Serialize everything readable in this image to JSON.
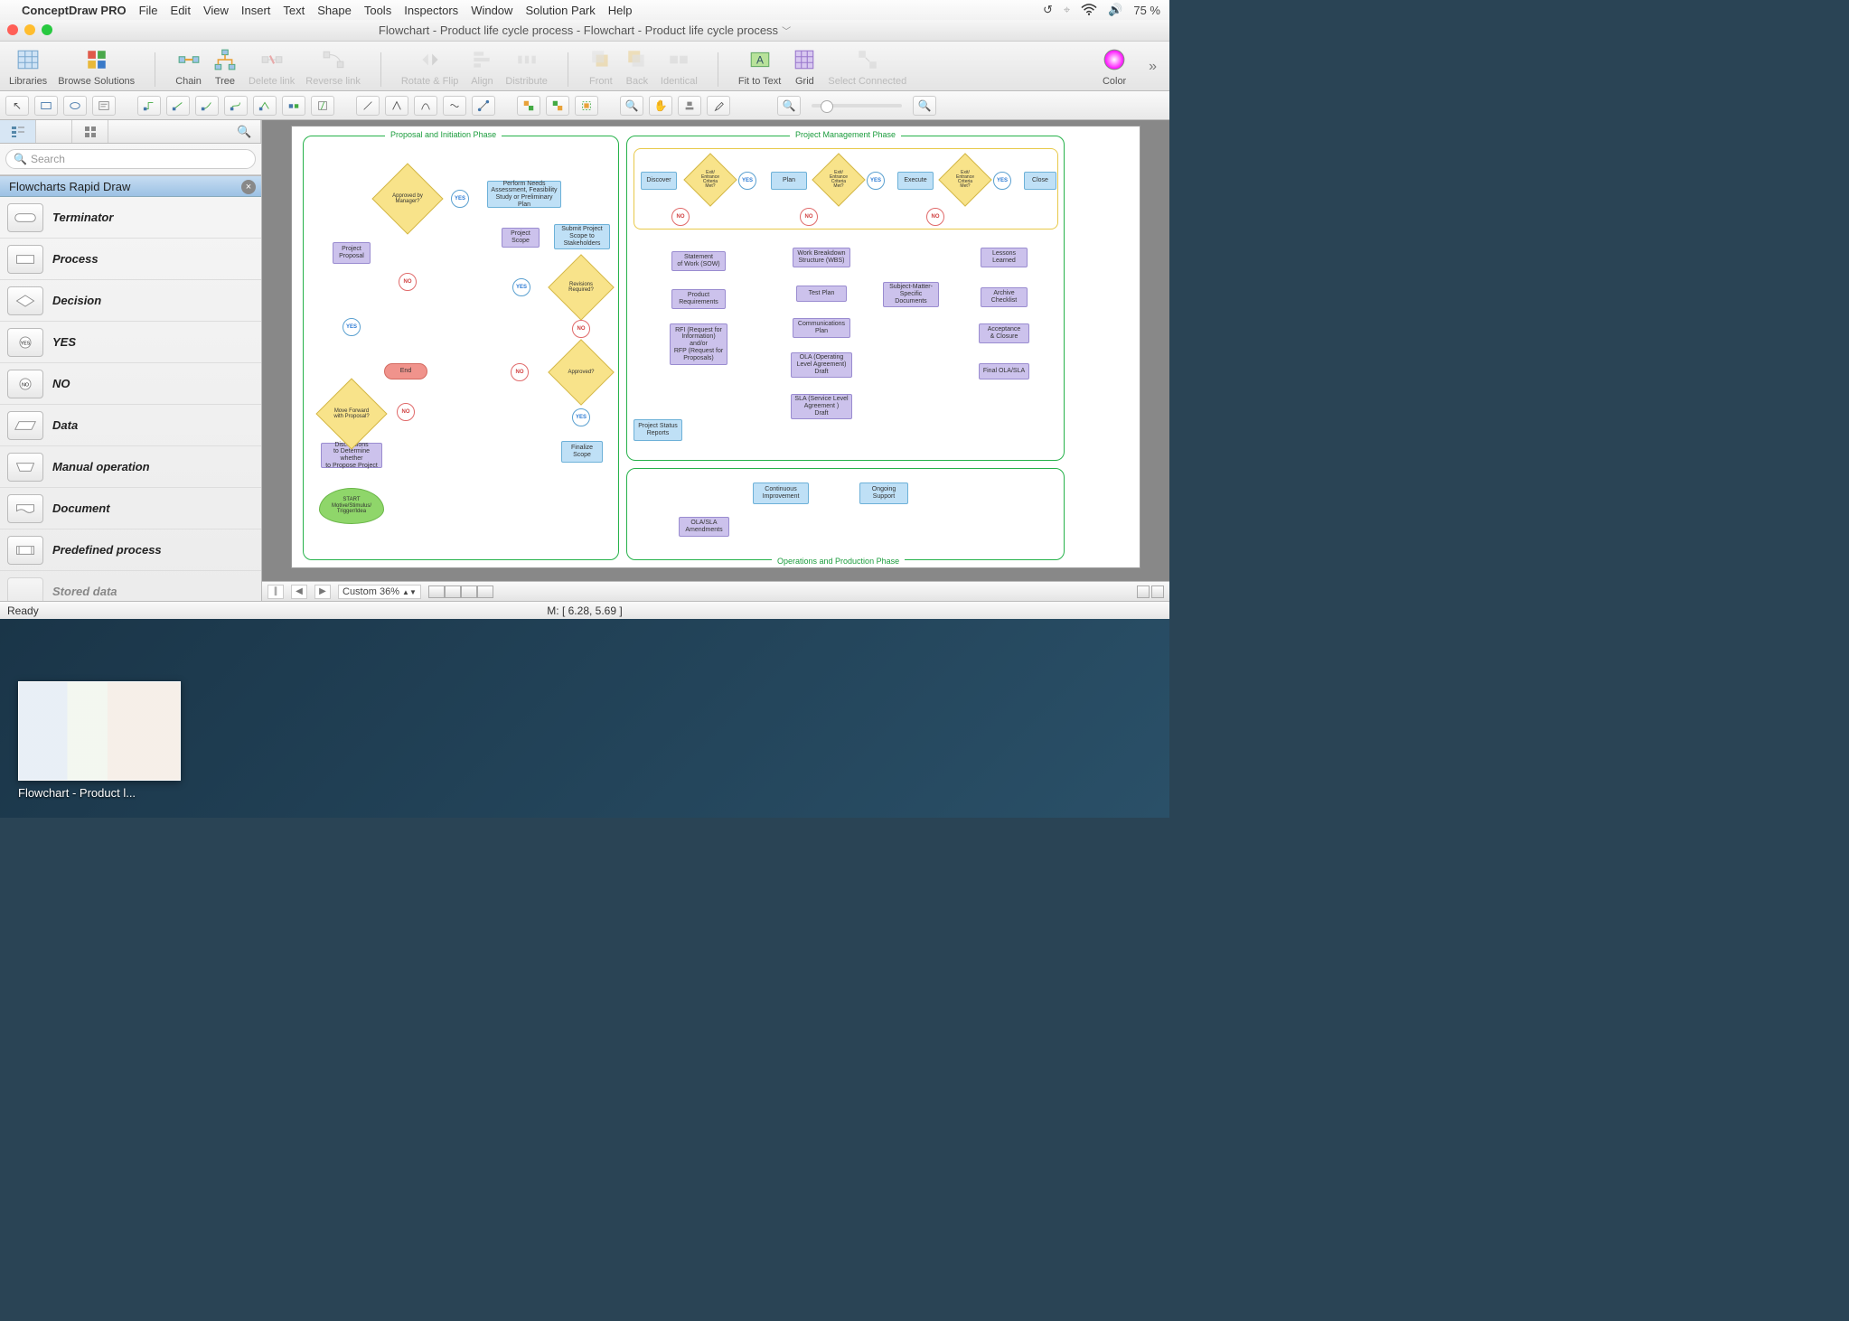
{
  "mac_menu": {
    "app": "ConceptDraw PRO",
    "items": [
      "File",
      "Edit",
      "View",
      "Insert",
      "Text",
      "Shape",
      "Tools",
      "Inspectors",
      "Window",
      "Solution Park",
      "Help"
    ],
    "battery": "75 %"
  },
  "window": {
    "title": "Flowchart - Product life cycle process - Flowchart - Product life cycle process"
  },
  "toolbar": {
    "libraries": "Libraries",
    "browse": "Browse Solutions",
    "chain": "Chain",
    "tree": "Tree",
    "delete_link": "Delete link",
    "reverse_link": "Reverse link",
    "rotate": "Rotate & Flip",
    "align": "Align",
    "distribute": "Distribute",
    "front": "Front",
    "back": "Back",
    "identical": "Identical",
    "fit": "Fit to Text",
    "grid": "Grid",
    "select_conn": "Select Connected",
    "color": "Color"
  },
  "sidebar": {
    "search_placeholder": "Search",
    "library_title": "Flowcharts Rapid Draw",
    "items": [
      {
        "label": "Terminator"
      },
      {
        "label": "Process"
      },
      {
        "label": "Decision"
      },
      {
        "label": "YES"
      },
      {
        "label": "NO"
      },
      {
        "label": "Data"
      },
      {
        "label": "Manual operation"
      },
      {
        "label": "Document"
      },
      {
        "label": "Predefined process"
      },
      {
        "label": "Stored data"
      }
    ]
  },
  "flowchart": {
    "phase1": "Proposal and Initiation Phase",
    "phase2": "Project Management Phase",
    "phase3": "Operations and Production Phase",
    "nodes": {
      "start": "START\nMotive/Stimulus/\nTrigger/Idea",
      "discussions": "Discussions\nto Determine whether\nto Propose Project",
      "move_forward": "Move Forward\nwith Proposal?",
      "proj_proposal": "Project\nProposal",
      "approved_mgr": "Approved by\nManager?",
      "perform_needs": "Perform Needs\nAssessment, Feasibility\nStudy or Preliminary Plan",
      "proj_scope": "Project\nScope",
      "submit_scope": "Submit Project\nScope to\nStakeholders",
      "revisions": "Revisions\nRequired?",
      "approved": "Approved?",
      "finalize": "Finalize\nScope",
      "end": "End",
      "discover": "Discover",
      "plan": "Plan",
      "execute": "Execute",
      "close": "Close",
      "exit_crit": "Exit/\nEntrance\nCriteria\nMet?",
      "sow": "Statement\nof Work (SOW)",
      "prod_req": "Product\nRequirements",
      "rfi": "RFI (Request for\nInformation)\nand/or\nRFP (Request for\nProposals)",
      "status_rep": "Project Status\nReports",
      "wbs": "Work Breakdown\nStructure (WBS)",
      "test_plan": "Test Plan",
      "comm_plan": "Communications\nPlan",
      "ola": "OLA (Operating\nLevel Agreement)\nDraft",
      "sla": "SLA (Service Level\nAgreement )\nDraft",
      "sme_docs": "Subject-Matter-\nSpecific\nDocuments",
      "lessons": "Lessons\nLearned",
      "archive": "Archive\nChecklist",
      "accept": "Acceptance\n& Closure",
      "final_sla": "Final OLA/SLA",
      "cont_improve": "Continuous\nImprovement",
      "ongoing": "Ongoing\nSupport",
      "ola_amend": "OLA/SLA\nAmendments",
      "yes": "YES",
      "no": "NO"
    }
  },
  "bottom": {
    "zoom": "Custom 36%",
    "coords": "M: [ 6.28, 5.69 ]"
  },
  "status": {
    "ready": "Ready"
  },
  "dock": {
    "caption": "Flowchart - Product l..."
  }
}
